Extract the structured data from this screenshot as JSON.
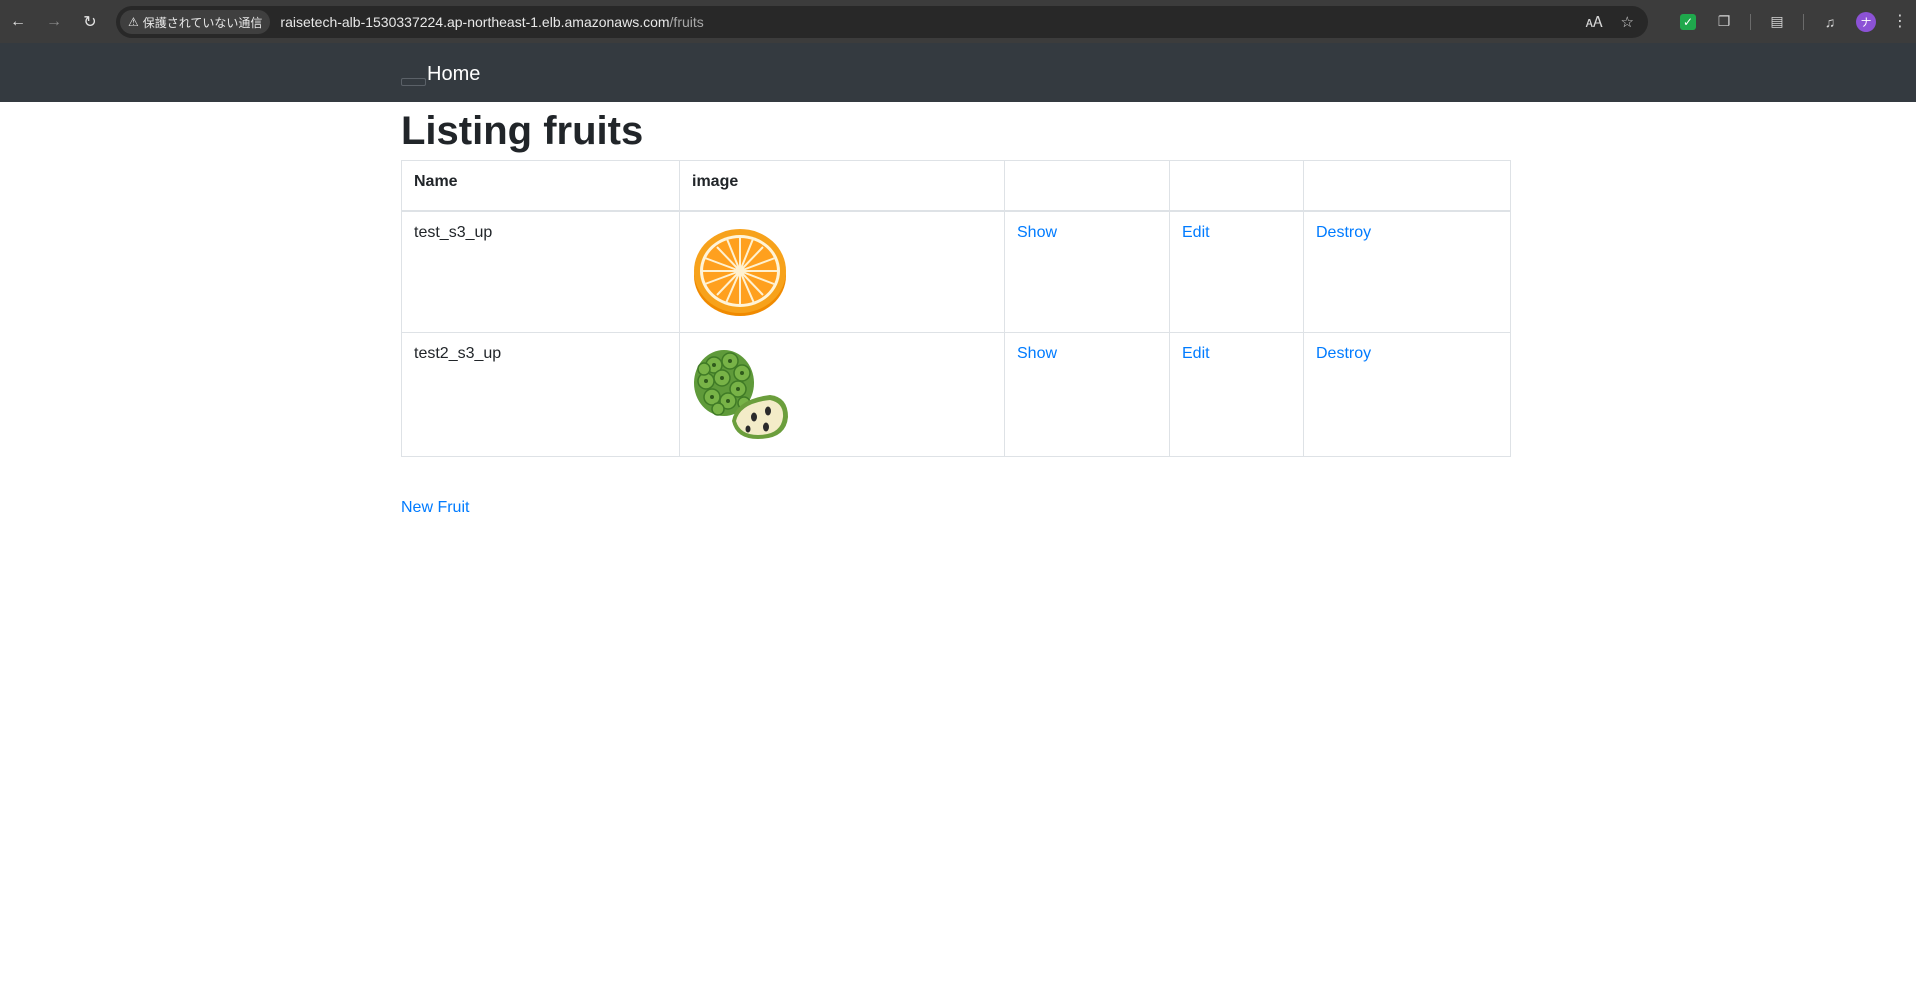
{
  "browser": {
    "security_label": "保護されていない通信",
    "url_host": "raisetech-alb-1530337224.ap-northeast-1.elb.amazonaws.com",
    "url_path": "/fruits",
    "avatar_initial": "ナ"
  },
  "navbar": {
    "brand": "Home"
  },
  "page": {
    "title": "Listing fruits",
    "columns": [
      "Name",
      "image",
      "",
      "",
      ""
    ],
    "rows": [
      {
        "name": "test_s3_up",
        "image": "orange-image",
        "show": "Show",
        "edit": "Edit",
        "destroy": "Destroy"
      },
      {
        "name": "test2_s3_up",
        "image": "custard-apple-image",
        "show": "Show",
        "edit": "Edit",
        "destroy": "Destroy"
      }
    ],
    "new_link": "New Fruit"
  },
  "colors": {
    "link": "#007bff",
    "navbar_bg": "#343a40",
    "chrome_bg": "#3c3c3c"
  }
}
